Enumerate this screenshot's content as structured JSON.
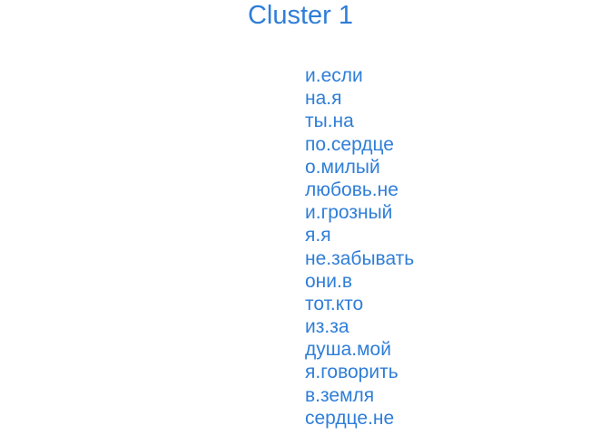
{
  "title": "Cluster 1",
  "accent_color": "#2f7ed8",
  "terms": [
    "и.если",
    "на.я",
    "ты.на",
    "по.сердце",
    "о.милый",
    "любовь.не",
    "и.грозный",
    "я.я",
    "не.забывать",
    "они.в",
    "тот.кто",
    "из.за",
    "душа.мой",
    "я.говорить",
    "в.земля",
    "сердце.не"
  ]
}
